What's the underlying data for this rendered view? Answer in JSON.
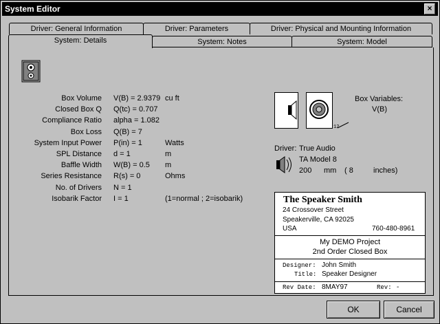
{
  "window": {
    "title": "System Editor",
    "close": "×"
  },
  "tabs_back": [
    {
      "label": "Driver:  General Information"
    },
    {
      "label": "Driver:  Parameters"
    },
    {
      "label": "Driver:  Physical and Mounting Information"
    }
  ],
  "tabs_front": [
    {
      "label": "System:  Details"
    },
    {
      "label": "System:  Notes"
    },
    {
      "label": "System:  Model"
    }
  ],
  "params": [
    {
      "label": "Box Volume",
      "expr": "V(B) = 2.9379",
      "unit": "cu ft"
    },
    {
      "label": "Closed Box Q",
      "expr": "Q(tc) = 0.707",
      "unit": ""
    },
    {
      "label": "Compliance Ratio",
      "expr": "alpha = 1.082",
      "unit": ""
    },
    {
      "label": "Box Loss",
      "expr": "Q(B) = 7",
      "unit": ""
    },
    {
      "label": "System Input Power",
      "expr": "P(in) = 1",
      "unit": "Watts"
    },
    {
      "label": "SPL Distance",
      "expr": "d = 1",
      "unit": "m"
    },
    {
      "label": "Baffle Width",
      "expr": "W(B) = 0.5",
      "unit": "m"
    },
    {
      "label": "Series Resistance",
      "expr": "R(s) = 0",
      "unit": "Ohms"
    },
    {
      "label": "No. of Drivers",
      "expr": "N = 1",
      "unit": ""
    },
    {
      "label": "Isobarik Factor",
      "expr": "I = 1",
      "unit": "(1=normal ; 2=isobarik)"
    }
  ],
  "box_variables": {
    "title": "Box Variables:",
    "value": "V(B)",
    "dim": "12"
  },
  "driver": {
    "label": "Driver:",
    "brand": "True Audio",
    "model": "TA Model 8",
    "size_mm": "200",
    "mm_unit": "mm",
    "size_in": "( 8",
    "in_unit": "inches)"
  },
  "company": {
    "name": "The Speaker Smith",
    "street": "24 Crossover Street",
    "city": "Speakerville, CA 92025",
    "country": "USA",
    "phone": "760-480-8961"
  },
  "project": {
    "name": "My DEMO Project",
    "subtitle": "2nd Order Closed Box"
  },
  "designer": {
    "designer_label": "Designer:",
    "designer": "John Smith",
    "title_label": "Title:",
    "title": "Speaker Designer"
  },
  "revision": {
    "date_label": "Rev Date:",
    "date": "8MAY97",
    "rev_label": "Rev:",
    "rev": "-"
  },
  "buttons": {
    "ok": "OK",
    "cancel": "Cancel"
  }
}
